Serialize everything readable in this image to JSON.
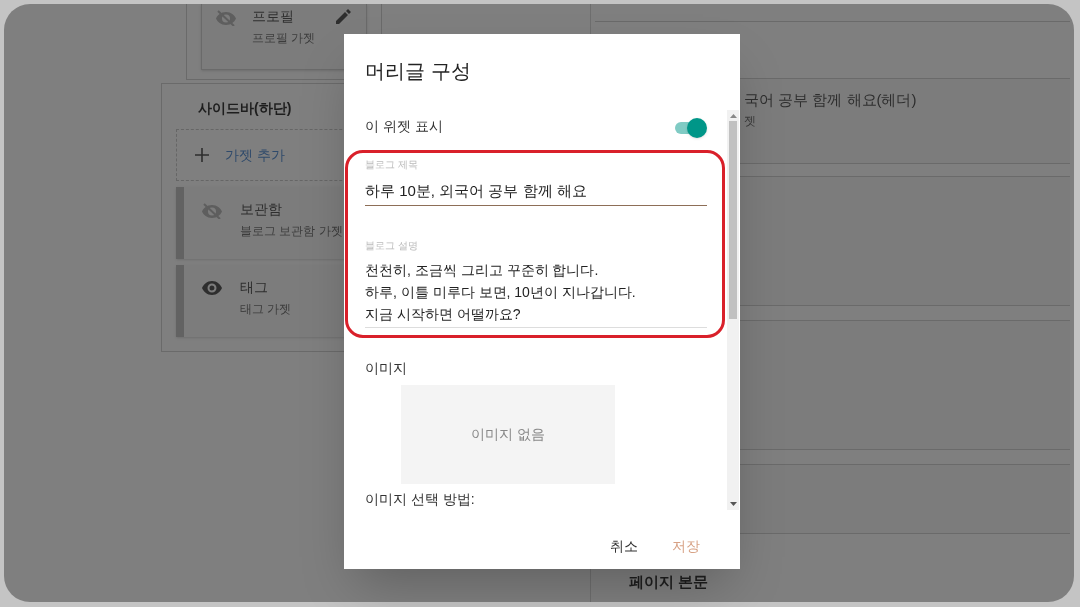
{
  "background": {
    "profile_gadget": {
      "title": "프로필",
      "subtitle": "프로필 가젯",
      "visible": false
    },
    "sidebar_section": {
      "title": "사이드바(하단)",
      "add_gadget": "가젯 추가",
      "gadgets": [
        {
          "title": "보관함",
          "subtitle": "블로그 보관함 가젯",
          "visible": false
        },
        {
          "title": "태그",
          "subtitle": "태그 가젯",
          "visible": true
        }
      ]
    },
    "header_gadget": {
      "title": "국어 공부 함께 해요(헤더)",
      "subtitle": "젯"
    },
    "main_section": {
      "title": "페이지 본문"
    }
  },
  "dialog": {
    "title": "머리글 구성",
    "show_widget": {
      "label": "이 위젯 표시",
      "on": true
    },
    "fields": [
      {
        "kind": "input",
        "label": "블로그 제목",
        "value": "하루 10분, 외국어 공부 함께 해요"
      },
      {
        "kind": "textarea",
        "label": "블로그 설명",
        "value": "천천히, 조금씩 그리고 꾸준히 합니다.\n하루, 이틀 미루다 보면, 10년이 지나갑니다.\n지금 시작하면 어떨까요?"
      }
    ],
    "image": {
      "label": "이미지",
      "empty_text": "이미지 없음"
    },
    "image_method_label": "이미지 선택 방법:",
    "buttons": [
      {
        "kind": "cancel",
        "label": "취소"
      },
      {
        "kind": "primary",
        "label": "저장"
      }
    ]
  }
}
